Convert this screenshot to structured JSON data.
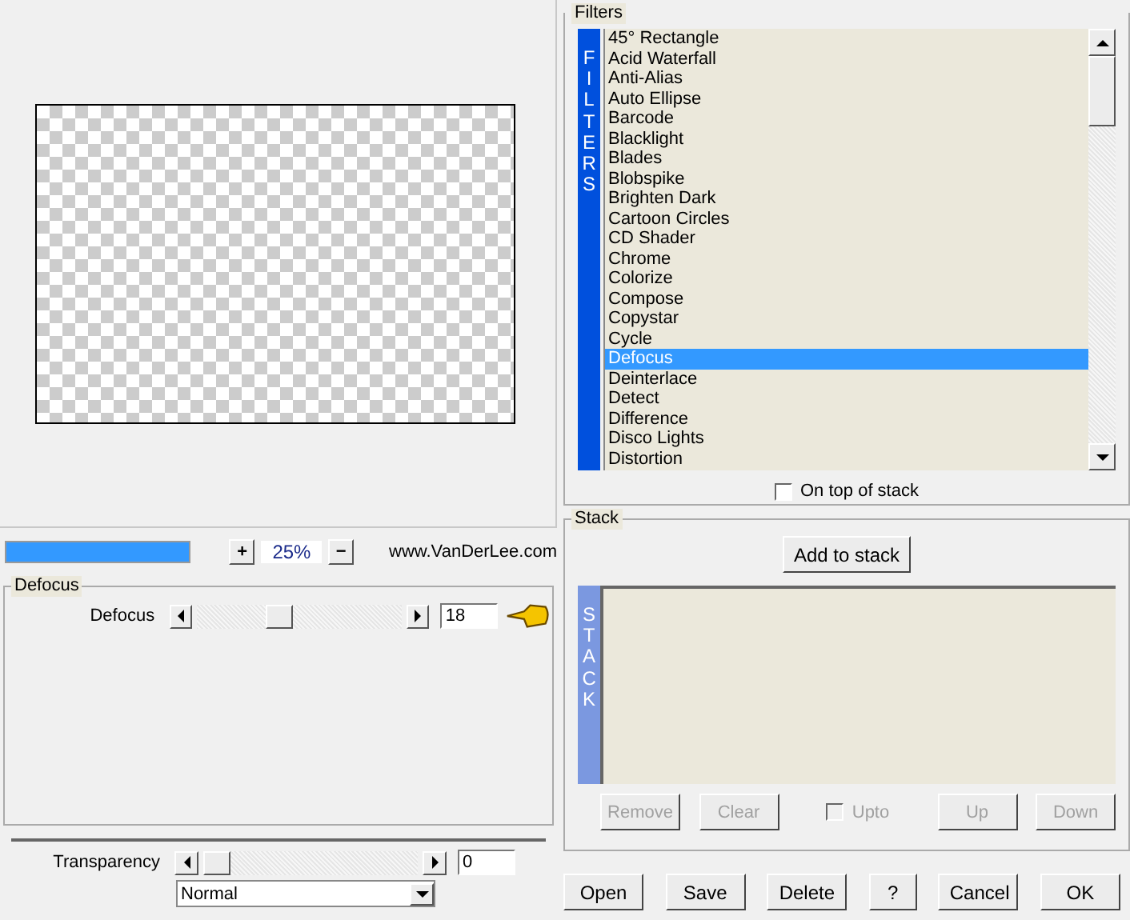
{
  "progress": {
    "level": 1
  },
  "zoom": {
    "plus": "+",
    "value": "25%",
    "minus": "−"
  },
  "website": "www.VanDerLee.com",
  "params": {
    "title": "Defocus",
    "sliders": [
      {
        "label": "Defocus",
        "level": 0.37,
        "value": "18"
      }
    ]
  },
  "transparency": {
    "label": "Transparency",
    "level": 0,
    "value": "0"
  },
  "blend_mode": {
    "value": "Normal"
  },
  "filters": {
    "title": "Filters",
    "strip_label": "FILTERS",
    "items": [
      {
        "label": "45° Rectangle",
        "selected": false
      },
      {
        "label": "Acid Waterfall",
        "selected": false
      },
      {
        "label": "Anti-Alias",
        "selected": false
      },
      {
        "label": "Auto Ellipse",
        "selected": false
      },
      {
        "label": "Barcode",
        "selected": false
      },
      {
        "label": "Blacklight",
        "selected": false
      },
      {
        "label": "Blades",
        "selected": false
      },
      {
        "label": "Blobspike",
        "selected": false
      },
      {
        "label": "Brighten Dark",
        "selected": false
      },
      {
        "label": "Cartoon Circles",
        "selected": false
      },
      {
        "label": "CD Shader",
        "selected": false
      },
      {
        "label": "Chrome",
        "selected": false
      },
      {
        "label": "Colorize",
        "selected": false
      },
      {
        "label": "Compose",
        "selected": false
      },
      {
        "label": "Copystar",
        "selected": false
      },
      {
        "label": "Cycle",
        "selected": false
      },
      {
        "label": "Defocus",
        "selected": true
      },
      {
        "label": "Deinterlace",
        "selected": false
      },
      {
        "label": "Detect",
        "selected": false
      },
      {
        "label": "Difference",
        "selected": false
      },
      {
        "label": "Disco Lights",
        "selected": false
      },
      {
        "label": "Distortion",
        "selected": false
      }
    ],
    "on_top": {
      "label": "On top of stack",
      "checked": false
    }
  },
  "stack": {
    "title": "Stack",
    "add_button": "Add to stack",
    "strip_label": "STACK",
    "buttons": [
      {
        "label": "Remove",
        "disabled": true
      },
      {
        "label": "Clear",
        "disabled": true
      },
      {
        "kind": "checkbox",
        "label": "Upto",
        "checked": false,
        "disabled": true
      },
      {
        "label": "Up",
        "disabled": true
      },
      {
        "label": "Down",
        "disabled": true
      }
    ]
  },
  "dialog_buttons": [
    "Open",
    "Save",
    "Delete",
    "?",
    "Cancel",
    "OK"
  ]
}
